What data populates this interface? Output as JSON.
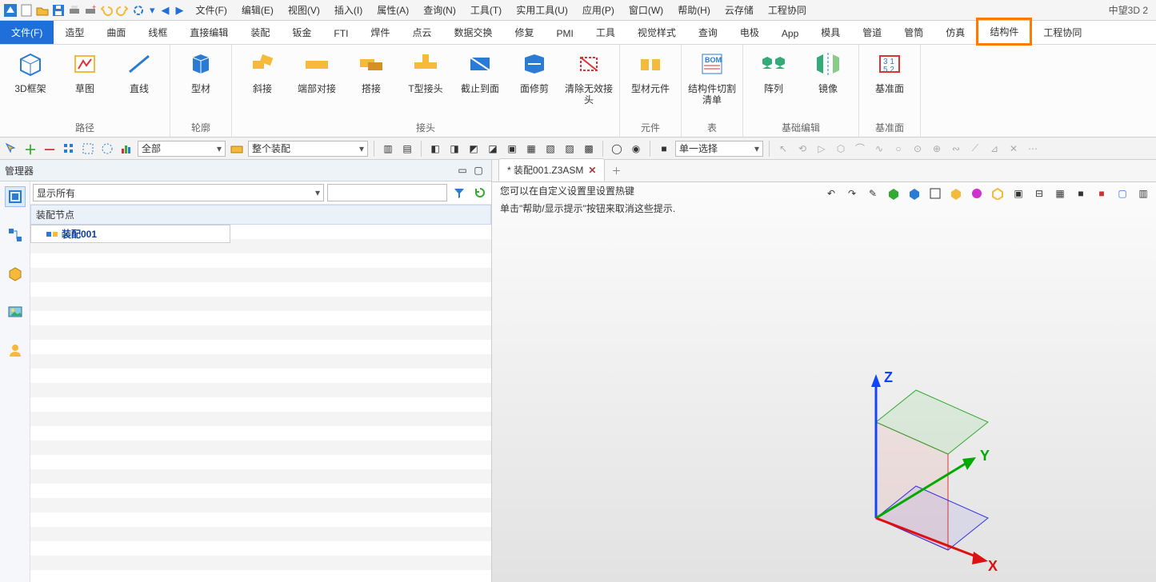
{
  "app": {
    "title": "中望3D 2"
  },
  "menubar": [
    "文件(F)",
    "编辑(E)",
    "视图(V)",
    "插入(I)",
    "属性(A)",
    "查询(N)",
    "工具(T)",
    "实用工具(U)",
    "应用(P)",
    "窗口(W)",
    "帮助(H)",
    "云存储",
    "工程协同"
  ],
  "ribbon_tabs": [
    "文件(F)",
    "造型",
    "曲面",
    "线框",
    "直接编辑",
    "装配",
    "钣金",
    "FTI",
    "焊件",
    "点云",
    "数据交换",
    "修复",
    "PMI",
    "工具",
    "视觉样式",
    "查询",
    "电极",
    "App",
    "模具",
    "管道",
    "管筒",
    "仿真",
    "结构件",
    "工程协同"
  ],
  "ribbon_active": "文件(F)",
  "ribbon_highlight": "结构件",
  "ribbon_groups": [
    {
      "label": "路径",
      "buttons": [
        {
          "label": "3D框架",
          "icon": "cube-wire"
        },
        {
          "label": "草图",
          "icon": "sketch"
        },
        {
          "label": "直线",
          "icon": "line"
        }
      ]
    },
    {
      "label": "轮廓",
      "buttons": [
        {
          "label": "型材",
          "icon": "profile"
        }
      ]
    },
    {
      "label": "接头",
      "buttons": [
        {
          "label": "斜接",
          "icon": "miter"
        },
        {
          "label": "端部对接",
          "icon": "endbutt"
        },
        {
          "label": "搭接",
          "icon": "lap"
        },
        {
          "label": "T型接头",
          "icon": "tee"
        },
        {
          "label": "截止到面",
          "icon": "trimface"
        },
        {
          "label": "面修剪",
          "icon": "facetrim"
        },
        {
          "label": "清除无效接头",
          "icon": "clear"
        }
      ]
    },
    {
      "label": "元件",
      "buttons": [
        {
          "label": "型材元件",
          "icon": "component"
        }
      ]
    },
    {
      "label": "表",
      "buttons": [
        {
          "label": "结构件切割清单",
          "icon": "bom"
        }
      ]
    },
    {
      "label": "基础编辑",
      "buttons": [
        {
          "label": "阵列",
          "icon": "pattern"
        },
        {
          "label": "镜像",
          "icon": "mirror"
        }
      ]
    },
    {
      "label": "基准面",
      "buttons": [
        {
          "label": "基准面",
          "icon": "datum"
        }
      ]
    }
  ],
  "toolbar2": {
    "combo1": "全部",
    "combo2": "整个装配",
    "combo3": "单一选择"
  },
  "manager": {
    "title": "管理器",
    "filter_combo": "显示所有",
    "section_header": "装配节点",
    "tree_root": "装配001"
  },
  "document": {
    "tab": "* 装配001.Z3ASM"
  },
  "viewport": {
    "hint1": "您可以在自定义设置里设置热键",
    "hint2": "单击\"帮助/显示提示\"按钮来取消这些提示.",
    "axis": {
      "x": "X",
      "y": "Y",
      "z": "Z"
    }
  }
}
